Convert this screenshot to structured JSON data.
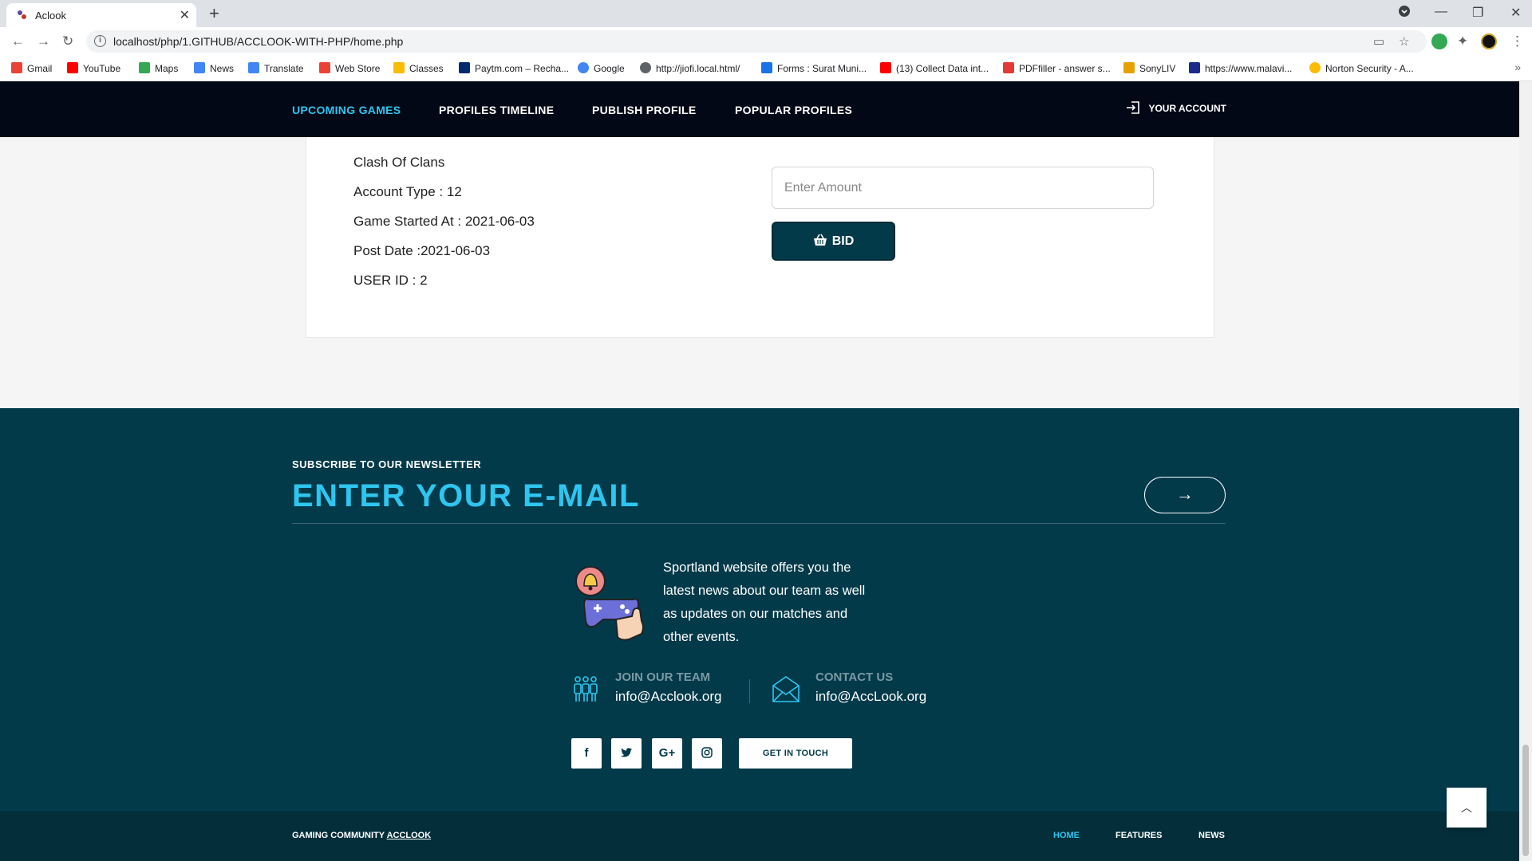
{
  "browser": {
    "tab_title": "Aclook",
    "url": "localhost/php/1.GITHUB/ACCLOOK-WITH-PHP/home.php",
    "bookmarks": [
      {
        "label": "Gmail",
        "color": "#ea4335"
      },
      {
        "label": "YouTube",
        "color": "#ff0000"
      },
      {
        "label": "Maps",
        "color": "#34a853"
      },
      {
        "label": "News",
        "color": "#4285f4"
      },
      {
        "label": "Translate",
        "color": "#4285f4"
      },
      {
        "label": "Web Store",
        "color": "#ea4335"
      },
      {
        "label": "Classes",
        "color": "#fbbc04"
      },
      {
        "label": "Paytm.com – Recha...",
        "color": "#002970"
      },
      {
        "label": "Google",
        "color": "#4285f4"
      },
      {
        "label": "http://jiofi.local.html/",
        "color": "#5f6368"
      },
      {
        "label": "Forms : Surat Muni...",
        "color": "#1a73e8"
      },
      {
        "label": "(13) Collect Data int...",
        "color": "#ff0000"
      },
      {
        "label": "PDFfiller - answer s...",
        "color": "#e53935"
      },
      {
        "label": "SonyLIV",
        "color": "#e6a100"
      },
      {
        "label": "https://www.malavi...",
        "color": "#1c2a8c"
      },
      {
        "label": "Norton Security - A...",
        "color": "#fbbc04"
      }
    ]
  },
  "nav": {
    "links": [
      "UPCOMING GAMES",
      "PROFILES TIMELINE",
      "PUBLISH PROFILE",
      "POPULAR PROFILES"
    ],
    "account": "YOUR ACCOUNT",
    "active_color": "#2ec5ef",
    "bg_color": "#020815"
  },
  "listing": {
    "game": "Clash Of Clans",
    "account_type": "Account Type : 12",
    "game_started": "Game Started At : 2021-06-03",
    "post_date": "Post Date :2021-06-03",
    "user_id": "USER ID : 2",
    "amount_placeholder": "Enter Amount",
    "bid_label": "BID"
  },
  "footer": {
    "subscribe_label": "SUBSCRIBE TO OUR NEWSLETTER",
    "email_placeholder": "ENTER YOUR E-MAIL",
    "about": "Sportland website offers you the latest news about our team as well as updates on our matches and other events.",
    "join_label": "JOIN OUR TEAM",
    "join_email": "info@Acclook.org",
    "contact_label": "CONTACT US",
    "contact_email": "info@AccLook.org",
    "socials": [
      "f",
      "t",
      "G+",
      "ig"
    ],
    "get_in_touch": "GET IN TOUCH",
    "copyright_prefix": "GAMING COMMUNITY ",
    "copyright_brand": "ACCLOOK",
    "links": [
      "HOME",
      "FEATURES",
      "NEWS"
    ],
    "bg_color": "#023a4a"
  }
}
